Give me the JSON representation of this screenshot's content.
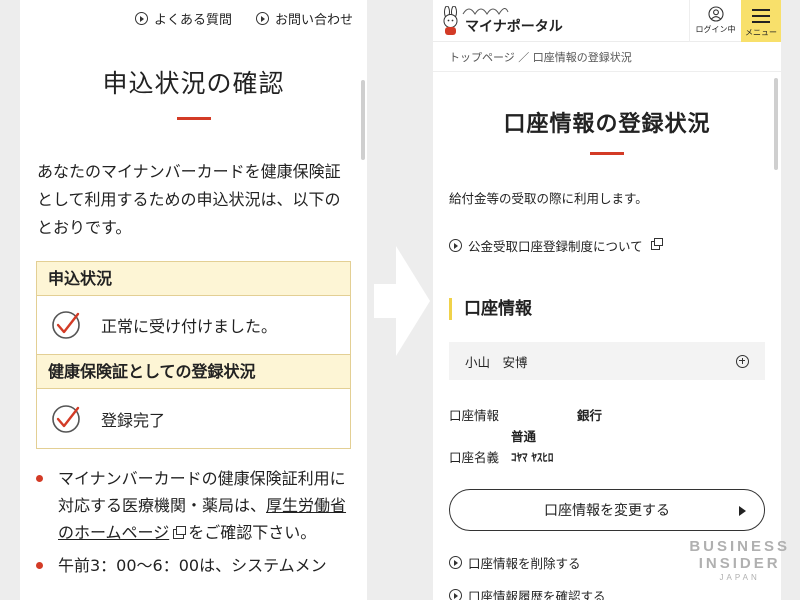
{
  "left": {
    "header_links": [
      "よくある質問",
      "お問い合わせ"
    ],
    "title": "申込状況の確認",
    "intro": "あなたのマイナンバーカードを健康保険証として利用するための申込状況は、以下のとおりです。",
    "status_sections": [
      {
        "heading": "申込状況",
        "value": "正常に受け付けました。"
      },
      {
        "heading": "健康保険証としての登録状況",
        "value": "登録完了"
      }
    ],
    "bullet1_pre": "マイナンバーカードの健康保険証利用に対応する医療機関・薬局は、",
    "bullet1_link": "厚生労働省のホームページ",
    "bullet1_post": "をご確認下さい。",
    "bullet2": "午前3：00〜6：00は、システムメン"
  },
  "right": {
    "logo_text": "マイナポータル",
    "login_label": "ログイン中",
    "menu_label": "メニュー",
    "breadcrumb": "トップページ ／ 口座情報の登録状況",
    "title": "口座情報の登録状況",
    "description": "給付金等の受取の際に利用します。",
    "system_link": "公金受取口座登録制度について",
    "section_heading": "口座情報",
    "account_holder": "小山　安博",
    "account_info_label": "口座情報",
    "bank_suffix": "銀行",
    "account_type": "普通",
    "account_name_label": "口座名義",
    "account_name": "ｺﾔﾏ ﾔｽﾋﾛ",
    "change_button": "口座情報を変更する",
    "delete_link": "口座情報を削除する",
    "history_link": "口座情報履歴を確認する"
  },
  "watermark": {
    "line1": "BUSINESS",
    "line2": "INSIDER",
    "line3": "JAPAN"
  },
  "colors": {
    "accent_red": "#d33b26",
    "accent_yellow": "#f8e06b",
    "status_header_bg": "#fdf5d5"
  }
}
